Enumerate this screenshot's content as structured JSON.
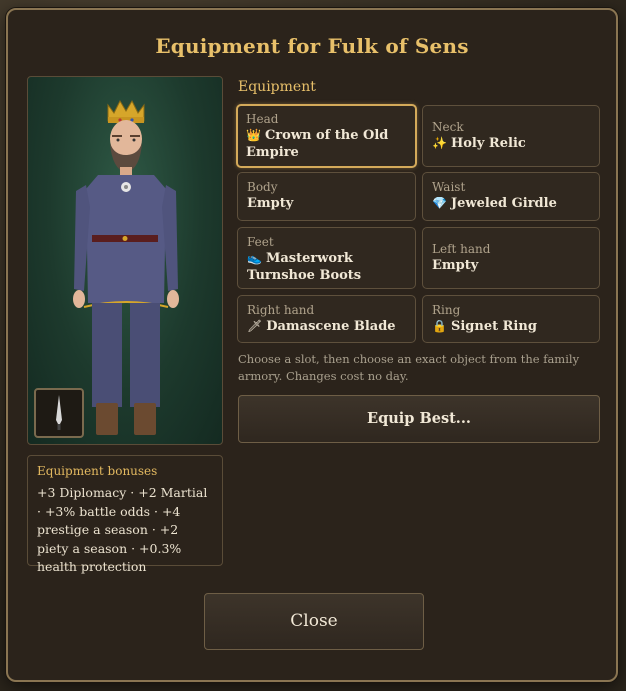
{
  "dialog": {
    "title": "Equipment for Fulk of Sens"
  },
  "equipment": {
    "section_label": "Equipment",
    "slots": [
      {
        "label": "Head",
        "icon": "👑",
        "icon_name": "crown-icon",
        "value": "Crown of the Old Empire",
        "selected": true
      },
      {
        "label": "Neck",
        "icon": "✨",
        "icon_name": "sparkle-icon",
        "value": "Holy Relic",
        "selected": false
      },
      {
        "label": "Body",
        "icon": "",
        "icon_name": "",
        "value": "Empty",
        "selected": false
      },
      {
        "label": "Waist",
        "icon": "💎",
        "icon_name": "gem-icon",
        "value": "Jeweled Girdle",
        "selected": false
      },
      {
        "label": "Feet",
        "icon": "👟",
        "icon_name": "boot-icon",
        "value": "Masterwork Turnshoe Boots",
        "selected": false
      },
      {
        "label": "Left hand",
        "icon": "",
        "icon_name": "",
        "value": "Empty",
        "selected": false
      },
      {
        "label": "Right hand",
        "icon": "🗡",
        "icon_name": "dagger-icon",
        "value": "Damascene Blade",
        "selected": false
      },
      {
        "label": "Ring",
        "icon": "🔒",
        "icon_name": "ring-icon",
        "value": "Signet Ring",
        "selected": false
      }
    ],
    "hint": "Choose a slot, then choose an exact object from the family armory. Changes cost no day."
  },
  "bonuses": {
    "title": "Equipment bonuses",
    "text": "+3 Diplomacy · +2 Martial · +3% battle odds · +4 prestige a season · +2 piety a season · +0.3% health protection"
  },
  "buttons": {
    "equip_best": "Equip Best...",
    "close": "Close"
  },
  "colors": {
    "accent_gold": "#e8c06a",
    "panel_bg": "#2b231b",
    "portrait_bg": "#1d3a2d",
    "selected_border": "#d4aa5a"
  }
}
